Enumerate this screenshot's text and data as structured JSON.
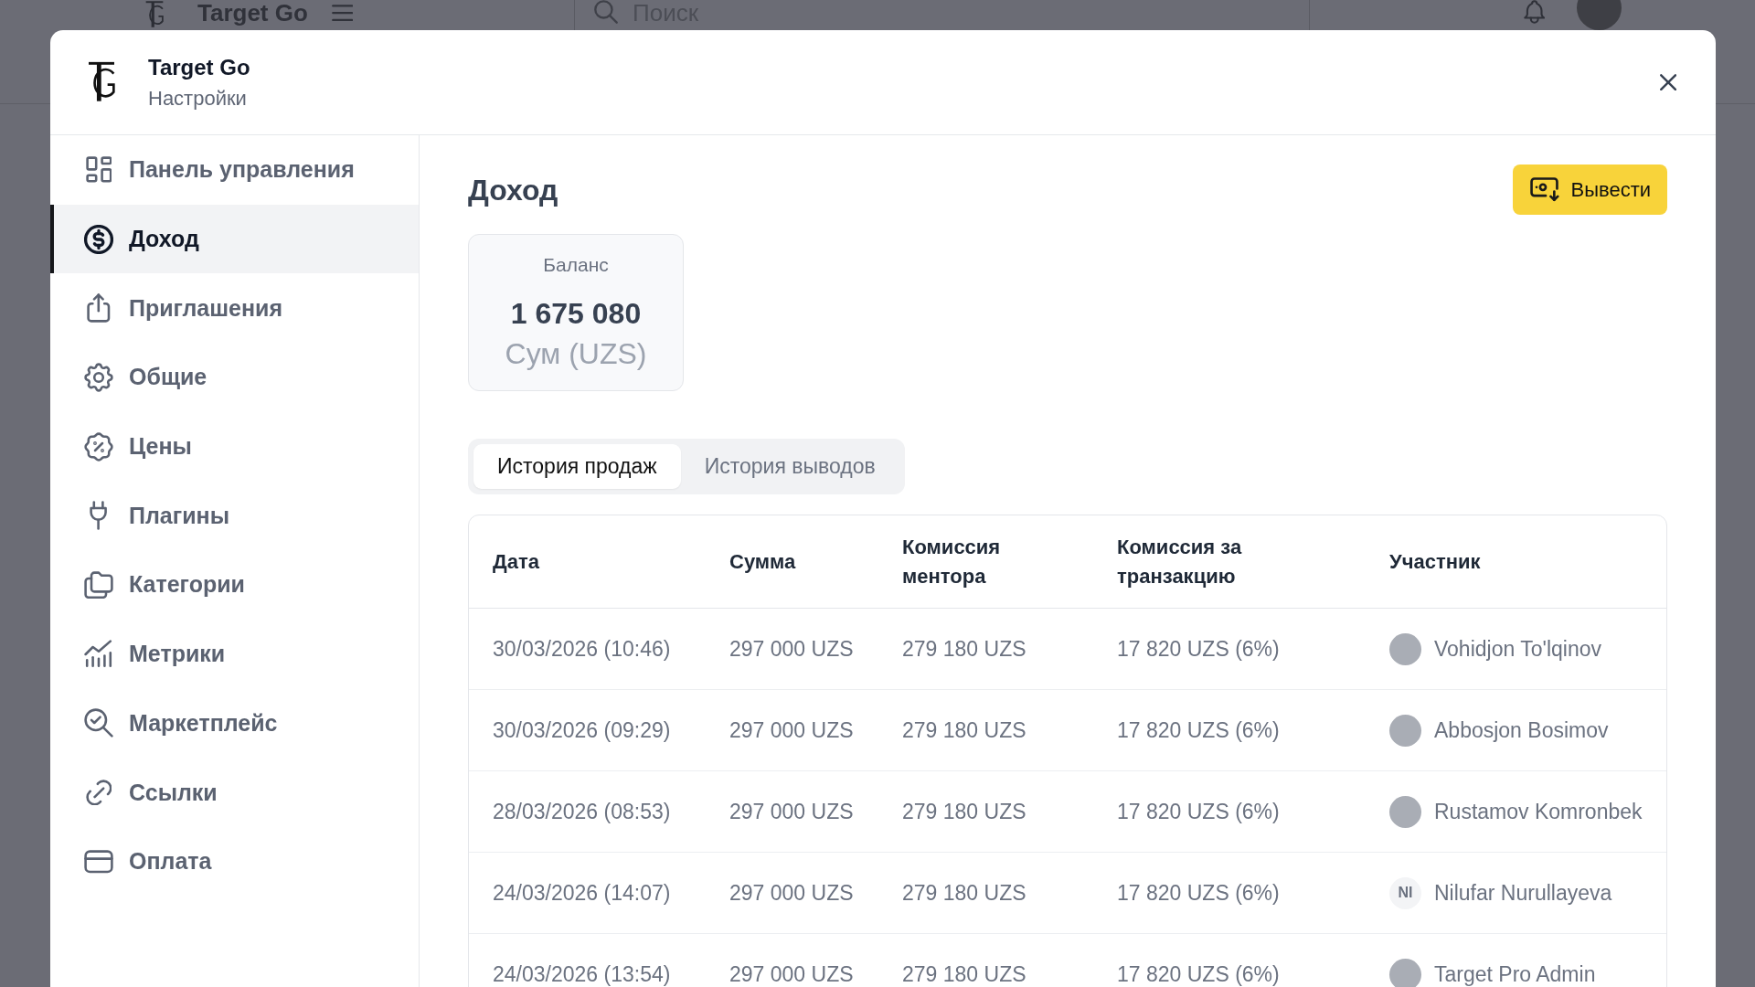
{
  "app_bar": {
    "brand": "Target Go",
    "search": {
      "placeholder": "Поиск"
    }
  },
  "modal": {
    "brand": "Target Go",
    "subtitle": "Настройки"
  },
  "sidebar": {
    "items": [
      {
        "label": "Панель управления",
        "selected": false
      },
      {
        "label": "Доход",
        "selected": true
      },
      {
        "label": "Приглашения",
        "selected": false
      },
      {
        "label": "Общие",
        "selected": false
      },
      {
        "label": "Цены",
        "selected": false
      },
      {
        "label": "Плагины",
        "selected": false
      },
      {
        "label": "Категории",
        "selected": false
      },
      {
        "label": "Метрики",
        "selected": false
      },
      {
        "label": "Маркетплейс",
        "selected": false
      },
      {
        "label": "Ссылки",
        "selected": false
      },
      {
        "label": "Оплата",
        "selected": false
      }
    ]
  },
  "content": {
    "title": "Доход",
    "withdraw_button": "Вывести",
    "balance": {
      "label": "Баланс",
      "amount": "1 675 080",
      "currency": "Сум (UZS)"
    },
    "tabs": [
      {
        "label": "История продаж",
        "selected": true
      },
      {
        "label": "История выводов",
        "selected": false
      }
    ],
    "table": {
      "columns": [
        "Дата",
        "Сумма",
        "Комиссия ментора",
        "Комиссия за транзакцию",
        "Участник"
      ],
      "rows": [
        {
          "date": "30/03/2026 (10:46)",
          "amount": "297 000 UZS",
          "mentor_commission": "279 180 UZS",
          "transaction_commission": "17 820 UZS (6%)",
          "participant": {
            "name": "Vohidjon To'lqinov",
            "avatar": {
              "kind": "photo"
            }
          }
        },
        {
          "date": "30/03/2026 (09:29)",
          "amount": "297 000 UZS",
          "mentor_commission": "279 180 UZS",
          "transaction_commission": "17 820 UZS (6%)",
          "participant": {
            "name": "Abbosjon Bosimov",
            "avatar": {
              "kind": "photo"
            }
          }
        },
        {
          "date": "28/03/2026 (08:53)",
          "amount": "297 000 UZS",
          "mentor_commission": "279 180 UZS",
          "transaction_commission": "17 820 UZS (6%)",
          "participant": {
            "name": "Rustamov Komronbek",
            "avatar": {
              "kind": "photo"
            }
          }
        },
        {
          "date": "24/03/2026 (14:07)",
          "amount": "297 000 UZS",
          "mentor_commission": "279 180 UZS",
          "transaction_commission": "17 820 UZS (6%)",
          "participant": {
            "name": "Nilufar Nurullayeva",
            "avatar": {
              "kind": "initials",
              "text": "NI"
            }
          }
        },
        {
          "date": "24/03/2026 (13:54)",
          "amount": "297 000 UZS",
          "mentor_commission": "279 180 UZS",
          "transaction_commission": "17 820 UZS (6%)",
          "participant": {
            "name": "Target Pro Admin",
            "avatar": {
              "kind": "photo"
            }
          }
        }
      ]
    }
  }
}
